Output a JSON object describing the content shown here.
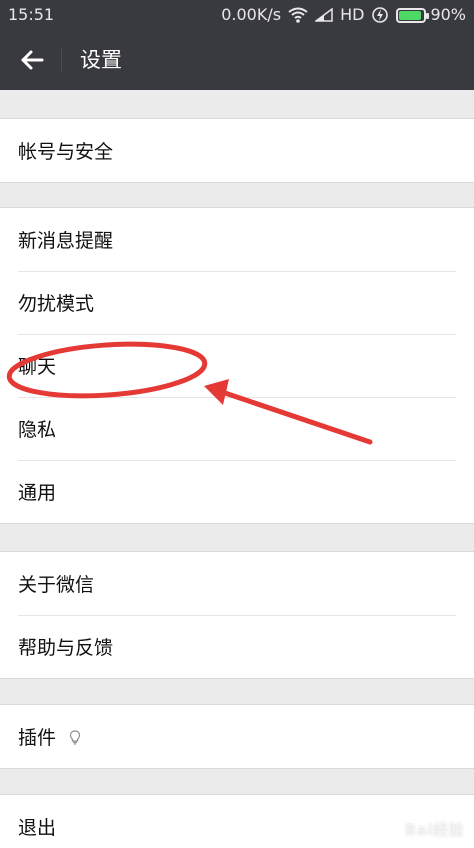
{
  "status_bar": {
    "time": "15:51",
    "network_speed": "0.00K/s",
    "hd_label": "HD",
    "battery_percent": "90%",
    "battery_level": 0.9,
    "battery_color": "#4cd964"
  },
  "app_bar": {
    "title": "设置",
    "back_icon": "arrow-left-icon",
    "background": "#393a3f"
  },
  "settings": {
    "group_1": {
      "items": [
        {
          "label": "帐号与安全"
        }
      ]
    },
    "group_2": {
      "items": [
        {
          "label": "新消息提醒"
        },
        {
          "label": "勿扰模式"
        },
        {
          "label": "聊天"
        },
        {
          "label": "隐私"
        },
        {
          "label": "通用"
        }
      ]
    },
    "group_3": {
      "items": [
        {
          "label": "关于微信"
        },
        {
          "label": "帮助与反馈"
        }
      ]
    },
    "group_4": {
      "items": [
        {
          "label": "插件",
          "icon": "lightbulb-icon"
        }
      ]
    },
    "group_5": {
      "items": [
        {
          "label": "退出"
        }
      ]
    }
  },
  "annotation": {
    "highlight_color": "#e53935",
    "target": "聊天"
  },
  "watermark": {
    "text": "Bai经验"
  }
}
